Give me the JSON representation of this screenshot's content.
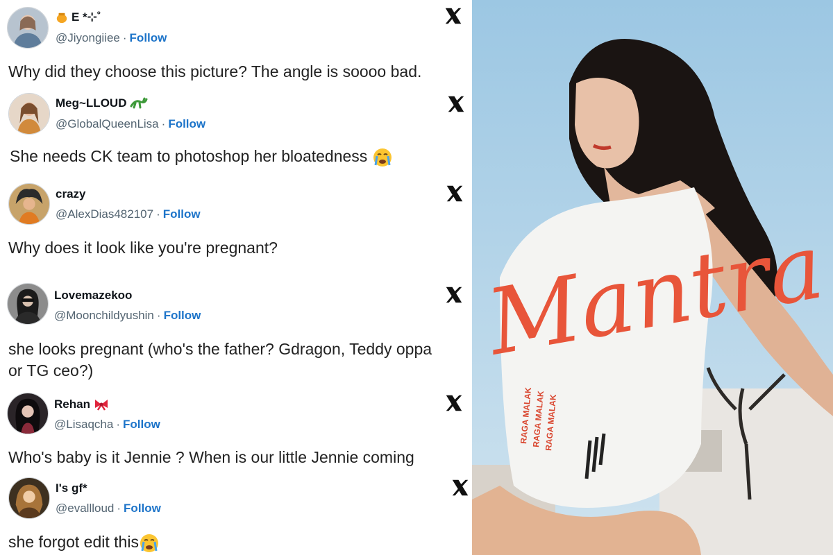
{
  "tweets": [
    {
      "name": "E *⊹˚",
      "handle": "@Jiyongiiee",
      "follow": "Follow",
      "text": "Why did they choose this picture? The angle is soooo bad."
    },
    {
      "name": "Meg~LLOUD",
      "handle": "@GlobalQueenLisa",
      "follow": "Follow",
      "text": "She needs CK team to photoshop her bloatedness"
    },
    {
      "name": "crazy",
      "handle": "@AlexDias482107",
      "follow": "Follow",
      "text": "Why does it look like you're pregnant?"
    },
    {
      "name": "Lovemazekoo",
      "handle": "@Moonchildyushin",
      "follow": "Follow",
      "text": "she looks pregnant (who's the father? Gdragon, Teddy oppa or TG ceo?)"
    },
    {
      "name": "Rehan",
      "handle": "@Lisaqcha",
      "follow": "Follow",
      "text": "Who's baby is it Jennie ? When is our little Jennie coming"
    },
    {
      "name": "I's gf*",
      "handle": "@evallloud",
      "follow": "Follow",
      "text": "she forgot edit this"
    }
  ],
  "poster": {
    "title": "Mantra",
    "shirt_text": "RAGA MALAK"
  },
  "colors": {
    "follow": "#1d74c9",
    "handle": "#536471",
    "title_orange": "#e8553a",
    "sky": "#a9cfe6"
  },
  "icons": [
    "x-logo-icon",
    "crying-face-icon",
    "lizard-icon",
    "bow-icon",
    "honey-pot-icon"
  ]
}
